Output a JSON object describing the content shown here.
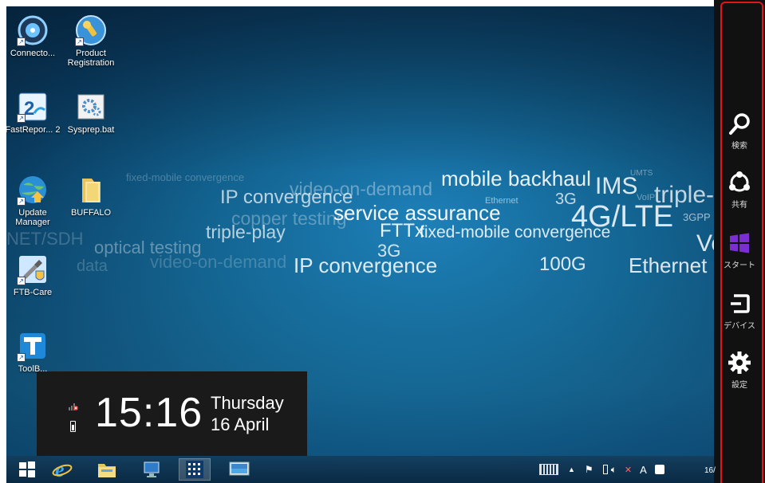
{
  "desktop": {
    "icons": [
      {
        "label": "Connecto...",
        "icon": "connector-icon"
      },
      {
        "label": "Product Registration",
        "icon": "key-globe-icon"
      },
      {
        "label": "FastRepor... 2",
        "icon": "fastreporter-icon"
      },
      {
        "label": "Sysprep.bat",
        "icon": "gear-batch-icon"
      },
      {
        "label": "Update Manager",
        "icon": "globe-update-icon"
      },
      {
        "label": "BUFFALO",
        "icon": "folder-icon"
      },
      {
        "label": "FTB-Care",
        "icon": "tools-shield-icon"
      },
      {
        "label": "ToolB...",
        "icon": "toolbox-icon"
      }
    ],
    "wallpaper_words": [
      "mobile backhaul",
      "IMS",
      "triple-p",
      "fixed-mobile convergence",
      "video-on-demand",
      "IP convergence",
      "service assurance",
      "4G/LTE",
      "3GPP",
      "copper testing",
      "triple-play",
      "FTTx",
      "fixed-mobile convergence",
      "NET/SDH",
      "optical testing",
      "video-on-demand",
      "3G",
      "IP convergence",
      "100G",
      "Ethernet",
      "Vo",
      "data",
      "UMTS",
      "VoIP",
      "Ethernet",
      "3G"
    ]
  },
  "clock": {
    "time": "15:16",
    "day": "Thursday",
    "date": "16 April"
  },
  "taskbar": {
    "buttons": [
      {
        "name": "start-button",
        "icon": "windows-logo-icon"
      },
      {
        "name": "internet-explorer-button",
        "icon": "ie-icon"
      },
      {
        "name": "file-explorer-button",
        "icon": "folder-icon"
      },
      {
        "name": "computer-button",
        "icon": "computer-icon"
      },
      {
        "name": "app-button-active",
        "icon": "grid-app-icon"
      },
      {
        "name": "remote-desktop-button",
        "icon": "monitor-icon"
      }
    ],
    "tray": {
      "ime": "A",
      "clock_partial": "16/"
    }
  },
  "charms": [
    {
      "label": "検索",
      "icon": "search-icon"
    },
    {
      "label": "共有",
      "icon": "share-icon"
    },
    {
      "label": "スタート",
      "icon": "windows-logo-icon"
    },
    {
      "label": "デバイス",
      "icon": "devices-icon"
    },
    {
      "label": "設定",
      "icon": "gear-icon"
    }
  ],
  "colors": {
    "charms_bg": "#111111",
    "highlight_outline": "#e4141b",
    "windows_logo": "#7b2fd1"
  }
}
